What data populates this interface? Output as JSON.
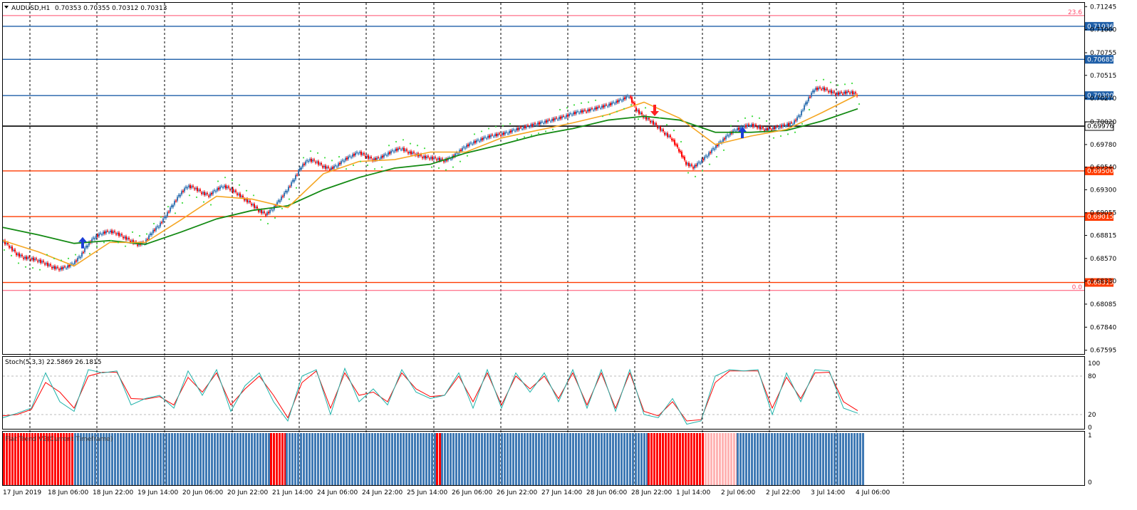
{
  "colors": {
    "up_candle": "#3a78b5",
    "down_candle": "#ff0000",
    "ma_fast": "#f5a623",
    "ma_slow": "#138a13",
    "sar": "#44dd44",
    "blue_line": "#1f5fa8",
    "red_line": "#ff3b00",
    "fib_line": "#ff4d6d",
    "stoch_main": "#20b2aa",
    "stoch_signal": "#ff0000",
    "flat_up": "#3f79b4",
    "flat_down": "#ff0000",
    "flat_flat": "#ffb3b3"
  },
  "header": {
    "symbol": "AUDUSD,H1",
    "ohlc": "0.70353 0.70355 0.70312 0.70313",
    "arrow_icon": "triangle-down-icon"
  },
  "price_levels": [
    {
      "label": "0.71036",
      "value": 0.71036,
      "kind": "blue"
    },
    {
      "label": "0.70685",
      "value": 0.70685,
      "kind": "blue"
    },
    {
      "label": "0.70300",
      "value": 0.703,
      "kind": "blue"
    },
    {
      "label": "0.69976",
      "value": 0.69976,
      "kind": "black"
    },
    {
      "label": "0.69500",
      "value": 0.695,
      "kind": "red"
    },
    {
      "label": "0.69015",
      "value": 0.69015,
      "kind": "red"
    },
    {
      "label": "0.68315",
      "value": 0.68315,
      "kind": "red"
    }
  ],
  "fib_levels": [
    {
      "label": "23.6",
      "value": 0.7115
    },
    {
      "label": "0.0",
      "value": 0.6823
    }
  ],
  "chart_data": [
    {
      "type": "line",
      "title": "AUDUSD,H1",
      "x_tick_labels": [
        "17 Jun 2019",
        "18 Jun 06:00",
        "18 Jun 22:00",
        "19 Jun 14:00",
        "20 Jun 06:00",
        "20 Jun 22:00",
        "21 Jun 14:00",
        "24 Jun 06:00",
        "24 Jun 22:00",
        "25 Jun 14:00",
        "26 Jun 06:00",
        "26 Jun 22:00",
        "27 Jun 14:00",
        "28 Jun 06:00",
        "28 Jun 22:00",
        "1 Jul 14:00",
        "2 Jul 06:00",
        "2 Jul 22:00",
        "3 Jul 14:00",
        "4 Jul 06:00"
      ],
      "y_tick_labels": [
        "0.71245",
        "0.71000",
        "0.70755",
        "0.70515",
        "0.70270",
        "0.70020",
        "0.69780",
        "0.69540",
        "0.69300",
        "0.69055",
        "0.68815",
        "0.68570",
        "0.68330",
        "0.68085",
        "0.67840",
        "0.67595"
      ],
      "ylim": [
        0.67555,
        0.71285
      ],
      "series": [
        {
          "name": "close",
          "x": [
            0,
            10,
            20,
            30,
            40,
            50,
            60,
            70,
            80,
            90,
            100,
            110,
            120,
            130,
            140,
            150,
            160,
            170,
            180,
            190,
            200,
            210,
            220,
            230,
            240,
            250,
            260,
            270,
            280,
            290,
            300,
            310,
            320,
            330,
            340,
            350,
            360,
            370,
            380,
            390,
            400,
            410,
            420,
            430,
            440,
            450,
            460,
            470,
            480,
            490,
            500,
            510,
            520,
            530,
            540,
            550,
            560,
            570,
            580,
            590,
            600,
            610,
            620,
            630,
            640,
            650,
            660,
            670,
            680,
            690,
            700,
            710,
            720,
            730,
            740,
            750,
            760,
            770,
            780,
            790,
            800,
            810,
            820,
            830,
            840,
            850,
            860,
            870,
            880,
            890,
            900,
            910,
            920,
            930,
            940,
            950,
            960,
            970,
            980,
            990,
            1000,
            1010,
            1020,
            1030,
            1040,
            1050,
            1060,
            1070,
            1080,
            1090,
            1100,
            1110,
            1120,
            1130,
            1140,
            1150,
            1160,
            1170,
            1180,
            1190,
            1200
          ],
          "y": [
            0.6876,
            0.687,
            0.6862,
            0.6858,
            0.6857,
            0.6855,
            0.6852,
            0.6848,
            0.6846,
            0.6848,
            0.6852,
            0.686,
            0.6872,
            0.688,
            0.6884,
            0.6886,
            0.6884,
            0.688,
            0.6876,
            0.6872,
            0.6874,
            0.6885,
            0.6892,
            0.6903,
            0.6915,
            0.6926,
            0.6934,
            0.6932,
            0.6927,
            0.6924,
            0.693,
            0.6934,
            0.6931,
            0.6926,
            0.692,
            0.6915,
            0.6908,
            0.6904,
            0.691,
            0.692,
            0.693,
            0.6942,
            0.6955,
            0.6962,
            0.696,
            0.6955,
            0.6952,
            0.6956,
            0.6962,
            0.6966,
            0.697,
            0.6966,
            0.6962,
            0.6964,
            0.6968,
            0.6972,
            0.6974,
            0.697,
            0.6968,
            0.6965,
            0.6964,
            0.6963,
            0.6961,
            0.6964,
            0.697,
            0.6976,
            0.698,
            0.6983,
            0.6986,
            0.6988,
            0.6989,
            0.6991,
            0.6994,
            0.6996,
            0.6998,
            0.7,
            0.7002,
            0.7004,
            0.7006,
            0.7008,
            0.7011,
            0.7013,
            0.7014,
            0.7016,
            0.7018,
            0.702,
            0.7023,
            0.7026,
            0.703,
            0.7015,
            0.7008,
            0.7003,
            0.6997,
            0.699,
            0.6984,
            0.6972,
            0.6958,
            0.6954,
            0.696,
            0.6967,
            0.6975,
            0.6982,
            0.6989,
            0.6994,
            0.6997,
            0.6999,
            0.6997,
            0.6994,
            0.6995,
            0.6997,
            0.6999,
            0.7001,
            0.701,
            0.7025,
            0.7037,
            0.7038,
            0.7035,
            0.7032,
            0.7033,
            0.7034,
            0.7031
          ]
        },
        {
          "name": "ma_fast",
          "x": [
            0,
            50,
            100,
            150,
            200,
            250,
            300,
            350,
            400,
            450,
            500,
            550,
            600,
            650,
            700,
            750,
            800,
            850,
            900,
            950,
            1000,
            1050,
            1100,
            1150,
            1200
          ],
          "y": [
            0.6876,
            0.6864,
            0.6849,
            0.6874,
            0.6874,
            0.6898,
            0.6923,
            0.692,
            0.6911,
            0.6947,
            0.696,
            0.6962,
            0.697,
            0.697,
            0.6985,
            0.6993,
            0.7001,
            0.701,
            0.7023,
            0.7006,
            0.6978,
            0.6987,
            0.6994,
            0.7012,
            0.7031
          ]
        },
        {
          "name": "ma_slow",
          "x": [
            0,
            50,
            100,
            150,
            200,
            250,
            300,
            350,
            400,
            450,
            500,
            550,
            600,
            650,
            700,
            750,
            800,
            850,
            900,
            950,
            1000,
            1050,
            1100,
            1150,
            1200
          ],
          "y": [
            0.689,
            0.6882,
            0.6873,
            0.6876,
            0.6872,
            0.6885,
            0.6899,
            0.6908,
            0.6913,
            0.693,
            0.6943,
            0.6953,
            0.6957,
            0.6969,
            0.6978,
            0.6988,
            0.6995,
            0.7004,
            0.7008,
            0.7004,
            0.6991,
            0.6991,
            0.6993,
            0.7003,
            0.7016
          ]
        }
      ],
      "signal_arrows": [
        {
          "x": 112,
          "y": 0.6873,
          "dir": "up",
          "color": "#1c3fd6"
        },
        {
          "x": 915,
          "y": 0.7015,
          "dir": "down",
          "color": "#ff2222"
        },
        {
          "x": 1038,
          "y": 0.699,
          "dir": "up",
          "color": "#1c3fd6"
        }
      ],
      "legend": "none"
    },
    {
      "type": "line",
      "title": "Stoch(5,3,3) 22.5869 26.1815",
      "y_tick_labels": [
        "100",
        "80",
        "20",
        "0"
      ],
      "ylim": [
        0,
        100
      ],
      "levels": [
        80,
        20
      ],
      "series": [
        {
          "name": "main",
          "x": [
            0,
            20,
            40,
            60,
            80,
            100,
            120,
            140,
            160,
            180,
            200,
            220,
            240,
            260,
            280,
            300,
            320,
            340,
            360,
            380,
            400,
            420,
            440,
            460,
            480,
            500,
            520,
            540,
            560,
            580,
            600,
            620,
            640,
            660,
            680,
            700,
            720,
            740,
            760,
            780,
            800,
            820,
            840,
            860,
            880,
            900,
            920,
            940,
            960,
            980,
            1000,
            1020,
            1040,
            1060,
            1080,
            1100,
            1120,
            1140,
            1160,
            1180,
            1200
          ],
          "y": [
            15,
            22,
            30,
            85,
            40,
            25,
            90,
            85,
            88,
            35,
            45,
            50,
            30,
            88,
            50,
            90,
            25,
            65,
            85,
            40,
            10,
            80,
            90,
            20,
            92,
            40,
            60,
            35,
            90,
            55,
            45,
            50,
            85,
            30,
            90,
            30,
            85,
            55,
            85,
            40,
            90,
            30,
            90,
            25,
            90,
            20,
            15,
            45,
            5,
            10,
            80,
            90,
            88,
            90,
            20,
            85,
            40,
            90,
            88,
            30,
            22
          ]
        },
        {
          "name": "signal",
          "x": [
            0,
            20,
            40,
            60,
            80,
            100,
            120,
            140,
            160,
            180,
            200,
            220,
            240,
            260,
            280,
            300,
            320,
            340,
            360,
            380,
            400,
            420,
            440,
            460,
            480,
            500,
            520,
            540,
            560,
            580,
            600,
            620,
            640,
            660,
            680,
            700,
            720,
            740,
            760,
            780,
            800,
            820,
            840,
            860,
            880,
            900,
            920,
            940,
            960,
            980,
            1000,
            1020,
            1040,
            1060,
            1080,
            1100,
            1120,
            1140,
            1160,
            1180,
            1200
          ],
          "y": [
            18,
            20,
            28,
            70,
            55,
            30,
            80,
            86,
            86,
            45,
            44,
            48,
            35,
            78,
            55,
            85,
            35,
            60,
            80,
            50,
            15,
            70,
            88,
            30,
            85,
            50,
            55,
            40,
            85,
            60,
            48,
            50,
            80,
            40,
            85,
            35,
            80,
            60,
            80,
            45,
            85,
            35,
            85,
            30,
            85,
            25,
            18,
            40,
            10,
            12,
            70,
            88,
            88,
            88,
            30,
            78,
            45,
            85,
            86,
            40,
            26
          ]
        }
      ]
    },
    {
      "type": "bar",
      "title": "Flat Trend V2(Current Timeframe)",
      "y_tick_labels": [
        "1",
        "0"
      ],
      "ylim": [
        0,
        1
      ],
      "segments": [
        {
          "from": 0,
          "to": 100,
          "state": "down"
        },
        {
          "from": 100,
          "to": 375,
          "state": "up"
        },
        {
          "from": 375,
          "to": 397,
          "state": "down"
        },
        {
          "from": 397,
          "to": 608,
          "state": "up"
        },
        {
          "from": 608,
          "to": 615,
          "state": "down"
        },
        {
          "from": 615,
          "to": 905,
          "state": "up"
        },
        {
          "from": 905,
          "to": 985,
          "state": "down"
        },
        {
          "from": 985,
          "to": 1030,
          "state": "flat"
        },
        {
          "from": 1030,
          "to": 1210,
          "state": "up"
        }
      ]
    }
  ]
}
